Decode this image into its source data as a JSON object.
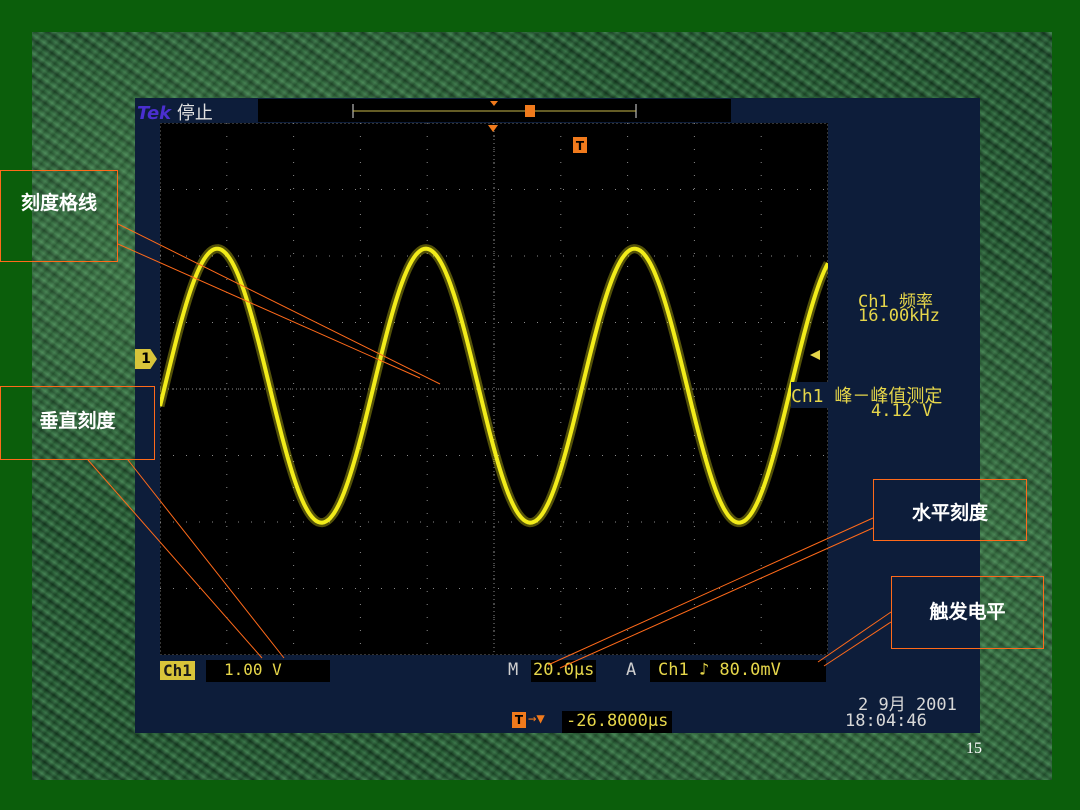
{
  "scope": {
    "brand": "Tek",
    "status": "停止",
    "ch1_marker": "1",
    "trigger_marker": "T",
    "measurements": {
      "freq_label": "Ch1 频率",
      "freq_value": "16.00kHz",
      "pp_label": "Ch1 峰－峰值测定",
      "pp_value": "4.12 V"
    },
    "bottom": {
      "channel": "Ch1",
      "volts_div": "1.00 V",
      "m_label": "M",
      "time_div": "20.0μs",
      "a_label": "A",
      "trigger": "Ch1 ♪ 80.0mV",
      "trig_offset_arrow": "→▼",
      "trig_offset": "-26.8000μs",
      "date": "2 9月  2001",
      "time": "18:04:46"
    }
  },
  "waveform": {
    "frequency_khz": 16.0,
    "time_per_div_us": 20.0,
    "peak_to_peak_v": 4.12,
    "volts_per_div": 1.0,
    "color": "#f2ec1a"
  },
  "callouts": {
    "grid": "刻度格线",
    "vertical": "垂直刻度",
    "horizontal": "水平刻度",
    "trigger_level": "触发电平"
  },
  "colors": {
    "callout_line": "#ff6a1a",
    "scope_text": "#e6d64a",
    "trigger_orange": "#f07a1c"
  },
  "page_number": "15"
}
